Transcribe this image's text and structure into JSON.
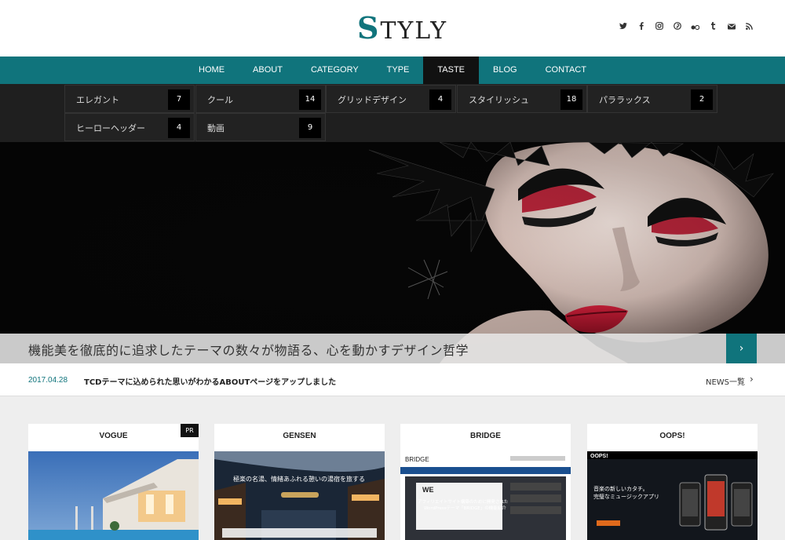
{
  "header": {
    "logo_first": "S",
    "logo_rest": "TYLY",
    "social_icons": [
      "twitter-icon",
      "facebook-icon",
      "instagram-icon",
      "pinterest-icon",
      "flickr-icon",
      "tumblr-icon",
      "mail-icon",
      "rss-icon"
    ]
  },
  "nav": {
    "items": [
      {
        "label": "HOME"
      },
      {
        "label": "ABOUT"
      },
      {
        "label": "CATEGORY"
      },
      {
        "label": "TYPE"
      },
      {
        "label": "TASTE"
      },
      {
        "label": "BLOG"
      },
      {
        "label": "CONTACT"
      }
    ],
    "active": "TASTE"
  },
  "dropdown": {
    "items": [
      {
        "label": "エレガント",
        "count": "7"
      },
      {
        "label": "クール",
        "count": "14"
      },
      {
        "label": "グリッドデザイン",
        "count": "4"
      },
      {
        "label": "スタイリッシュ",
        "count": "18"
      },
      {
        "label": "パララックス",
        "count": "2"
      },
      {
        "label": "ヒーローヘッダー",
        "count": "4"
      },
      {
        "label": "動画",
        "count": "9"
      }
    ]
  },
  "hero": {
    "caption": "機能美を徹底的に追求したテーマの数々が物語る、心を動かすデザイン哲学",
    "next_glyph": "›"
  },
  "news": {
    "date": "2017.04.28",
    "title": "TCDテーマに込められた思いがわかるABOUTページをアップしました",
    "more": "NEWS一覧",
    "arrow": "›"
  },
  "cards": [
    {
      "title": "VOGUE",
      "badge": "PR"
    },
    {
      "title": "GENSEN"
    },
    {
      "title": "BRIDGE"
    },
    {
      "title": "OOPS!"
    }
  ],
  "card_screens": {
    "gensen_headline": "極楽の名湯、情緒あふれる憩いの湯宿を旅する",
    "bridge_logo": "BRIDGE",
    "bridge_we": "WE",
    "bridge_copy": "アフィリエイトサイト構築のために開発された",
    "bridge_copy2": "WordPressテーマ「BRIDGE」の機能紹介",
    "oops_logo": "OOPS!",
    "oops_copy": "音楽の新しいカタチ。",
    "oops_copy2": "完璧なミュージックアプリ"
  },
  "colors": {
    "accent": "#10747c",
    "nav_active": "#111111",
    "dropdown_bg": "#1f1f1f"
  }
}
